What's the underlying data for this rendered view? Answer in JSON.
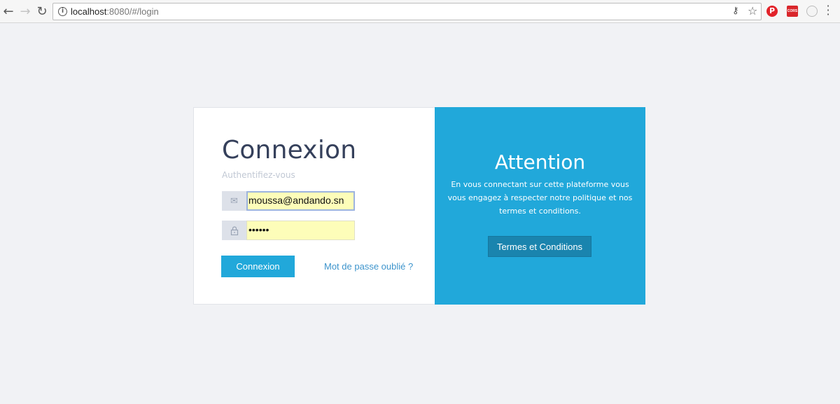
{
  "browser": {
    "url_host": "localhost",
    "url_rest": ":8080/#/login",
    "extensions": {
      "cors_label": "CORS"
    }
  },
  "login": {
    "title": "Connexion",
    "subtitle": "Authentifiez-vous",
    "email_value": "moussa@andando.sn",
    "password_value": "••••••",
    "submit_label": "Connexion",
    "forgot_label": "Mot de passe oublié ?"
  },
  "attention": {
    "title": "Attention",
    "text": "En vous connectant sur cette plateforme vous vous engagez à respecter notre politique et nos termes et conditions.",
    "terms_label": "Termes et Conditions"
  },
  "colors": {
    "accent": "#21a8da",
    "title": "#35405b",
    "autofill": "#fdfdb9",
    "terms_button": "#1a84ae"
  }
}
